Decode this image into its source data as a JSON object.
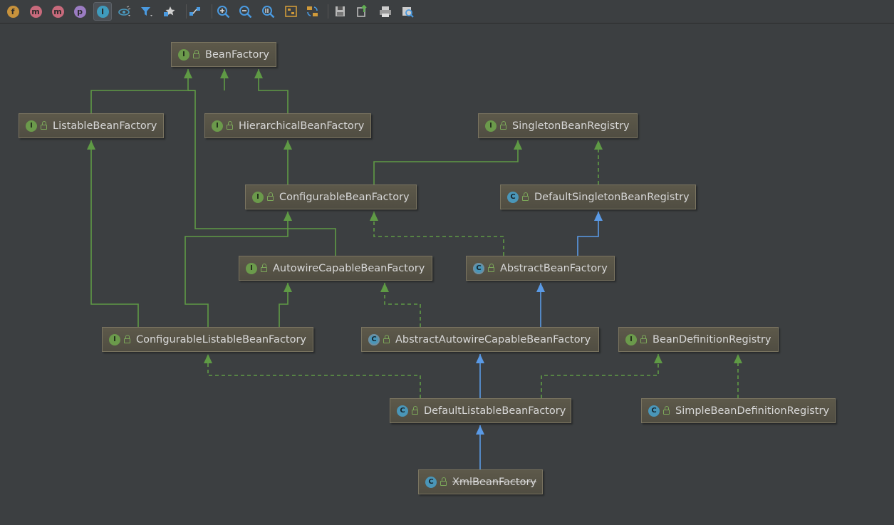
{
  "toolbar": {
    "buttons": [
      {
        "name": "show-fields-button",
        "icon": "field-icon",
        "glyph": "f",
        "color": "#c7923c"
      },
      {
        "name": "show-constructors-button",
        "icon": "constructor-icon",
        "glyph": "m",
        "color": "#c86a7c"
      },
      {
        "name": "show-methods-button",
        "icon": "method-icon",
        "glyph": "m",
        "color": "#c86a7c"
      },
      {
        "name": "show-properties-button",
        "icon": "property-icon",
        "glyph": "p",
        "color": "#9b7cc2"
      },
      {
        "name": "show-inner-classes-button",
        "icon": "interface-icon",
        "glyph": "I",
        "color": "#3f9bbd"
      },
      {
        "name": "visibility-button",
        "icon": "visibility-icon"
      },
      {
        "name": "filter-button",
        "icon": "filter-icon"
      },
      {
        "name": "mark-button",
        "icon": "star-icon"
      },
      {
        "name": "link-button",
        "icon": "link-icon"
      },
      {
        "name": "zoom-in-button",
        "icon": "zoom-in-icon"
      },
      {
        "name": "zoom-out-button",
        "icon": "zoom-out-icon"
      },
      {
        "name": "actual-size-button",
        "icon": "actual-size-icon"
      },
      {
        "name": "fit-content-button",
        "icon": "fit-content-icon"
      },
      {
        "name": "layout-button",
        "icon": "layout-icon"
      },
      {
        "name": "save-button",
        "icon": "save-icon"
      },
      {
        "name": "export-button",
        "icon": "export-icon"
      },
      {
        "name": "print-button",
        "icon": "print-icon"
      },
      {
        "name": "print-preview-button",
        "icon": "print-preview-icon"
      }
    ]
  },
  "diagram": {
    "nodes": [
      {
        "id": "BeanFactory",
        "label": "BeanFactory",
        "kind": "I"
      },
      {
        "id": "ListableBeanFactory",
        "label": "ListableBeanFactory",
        "kind": "I"
      },
      {
        "id": "HierarchicalBeanFactory",
        "label": "HierarchicalBeanFactory",
        "kind": "I"
      },
      {
        "id": "SingletonBeanRegistry",
        "label": "SingletonBeanRegistry",
        "kind": "I"
      },
      {
        "id": "ConfigurableBeanFactory",
        "label": "ConfigurableBeanFactory",
        "kind": "I"
      },
      {
        "id": "DefaultSingletonBeanRegistry",
        "label": "DefaultSingletonBeanRegistry",
        "kind": "C"
      },
      {
        "id": "AutowireCapableBeanFactory",
        "label": "AutowireCapableBeanFactory",
        "kind": "I"
      },
      {
        "id": "AbstractBeanFactory",
        "label": "AbstractBeanFactory",
        "kind": "C",
        "abstract": true
      },
      {
        "id": "ConfigurableListableBeanFactory",
        "label": "ConfigurableListableBeanFactory",
        "kind": "I"
      },
      {
        "id": "AbstractAutowireCapableBeanFactory",
        "label": "AbstractAutowireCapableBeanFactory",
        "kind": "C",
        "abstract": true
      },
      {
        "id": "BeanDefinitionRegistry",
        "label": "BeanDefinitionRegistry",
        "kind": "I"
      },
      {
        "id": "DefaultListableBeanFactory",
        "label": "DefaultListableBeanFactory",
        "kind": "C"
      },
      {
        "id": "SimpleBeanDefinitionRegistry",
        "label": "SimpleBeanDefinitionRegistry",
        "kind": "C"
      },
      {
        "id": "XmlBeanFactory",
        "label": "XmlBeanFactory",
        "kind": "C",
        "deprecated": true
      }
    ],
    "colors": {
      "extends_interface": "#5f9a45",
      "implements": "#5f9a45",
      "extends_class": "#5a9ae6"
    }
  }
}
